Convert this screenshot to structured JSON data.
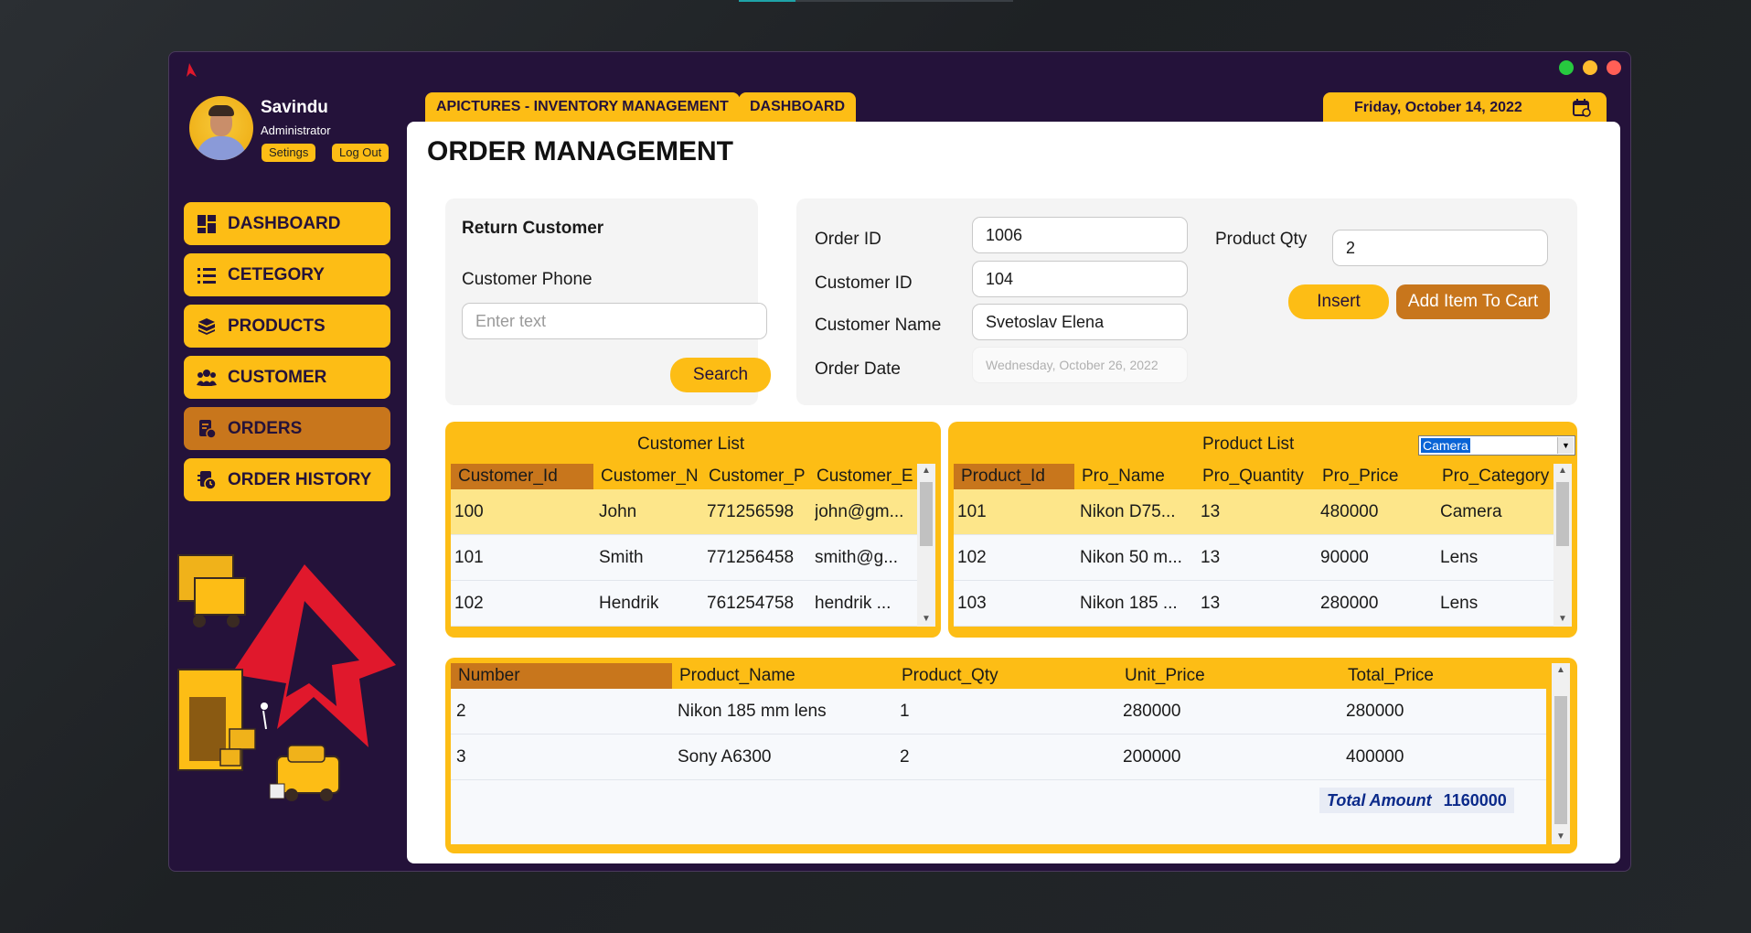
{
  "window": {
    "colors": {
      "brand_yellow": "#fdbd15",
      "brand_orange": "#c8761c",
      "sidebar_bg": "#24123a"
    }
  },
  "window_controls": [
    "green",
    "yellow",
    "red"
  ],
  "user": {
    "name": "Savindu",
    "role": "Administrator",
    "settings_label": "Setings",
    "logout_label": "Log Out"
  },
  "nav": [
    {
      "label": "DASHBOARD",
      "icon": "dashboard-icon"
    },
    {
      "label": "CETEGORY",
      "icon": "list-icon"
    },
    {
      "label": "PRODUCTS",
      "icon": "box-icon"
    },
    {
      "label": "CUSTOMER",
      "icon": "users-icon"
    },
    {
      "label": "ORDERS",
      "icon": "order-icon",
      "active": true
    },
    {
      "label": "ORDER HISTORY",
      "icon": "history-icon"
    }
  ],
  "tabs": {
    "app": "APICTURES - INVENTORY MANAGEMENT",
    "dashboard": "DASHBOARD"
  },
  "date": "Friday, October 14, 2022",
  "page_title": "ORDER MANAGEMENT",
  "return_customer": {
    "title": "Return Customer",
    "phone_label": "Customer Phone",
    "phone_placeholder": "Enter text",
    "search_label": "Search"
  },
  "order_form": {
    "order_id_label": "Order ID",
    "order_id": "1006",
    "customer_id_label": "Customer ID",
    "customer_id": "104",
    "customer_name_label": "Customer Name",
    "customer_name": "Svetoslav Elena",
    "order_date_label": "Order Date",
    "order_date": "Wednesday, October 26, 2022",
    "qty_label": "Product Qty",
    "qty": "2",
    "insert_label": "Insert",
    "add_to_cart_label": "Add Item To Cart"
  },
  "customer_list": {
    "title": "Customer List",
    "columns": [
      "Customer_Id",
      "Customer_N",
      "Customer_P",
      "Customer_E"
    ],
    "rows": [
      [
        "100",
        "John",
        "771256598",
        "john@gm..."
      ],
      [
        "101",
        "Smith",
        "771256458",
        "smith@g..."
      ],
      [
        "102",
        "Hendrik",
        "761254758",
        "hendrik ..."
      ]
    ]
  },
  "product_list": {
    "title": "Product List",
    "category_filter": "Camera",
    "columns": [
      "Product_Id",
      "Pro_Name",
      "Pro_Quantity",
      "Pro_Price",
      "Pro_Category"
    ],
    "rows": [
      [
        "101",
        "Nikon D75...",
        "13",
        "480000",
        "Camera"
      ],
      [
        "102",
        "Nikon 50 m...",
        "13",
        "90000",
        "Lens"
      ],
      [
        "103",
        "Nikon 185 ...",
        "13",
        "280000",
        "Lens"
      ]
    ]
  },
  "cart": {
    "columns": [
      "Number",
      "Product_Name",
      "Product_Qty",
      "Unit_Price",
      "Total_Price"
    ],
    "rows": [
      [
        "2",
        "Nikon 185 mm lens",
        "1",
        "280000",
        "280000"
      ],
      [
        "3",
        "Sony A6300",
        "2",
        "200000",
        "400000"
      ]
    ],
    "total_label": "Total Amount",
    "total_value": "1160000"
  }
}
